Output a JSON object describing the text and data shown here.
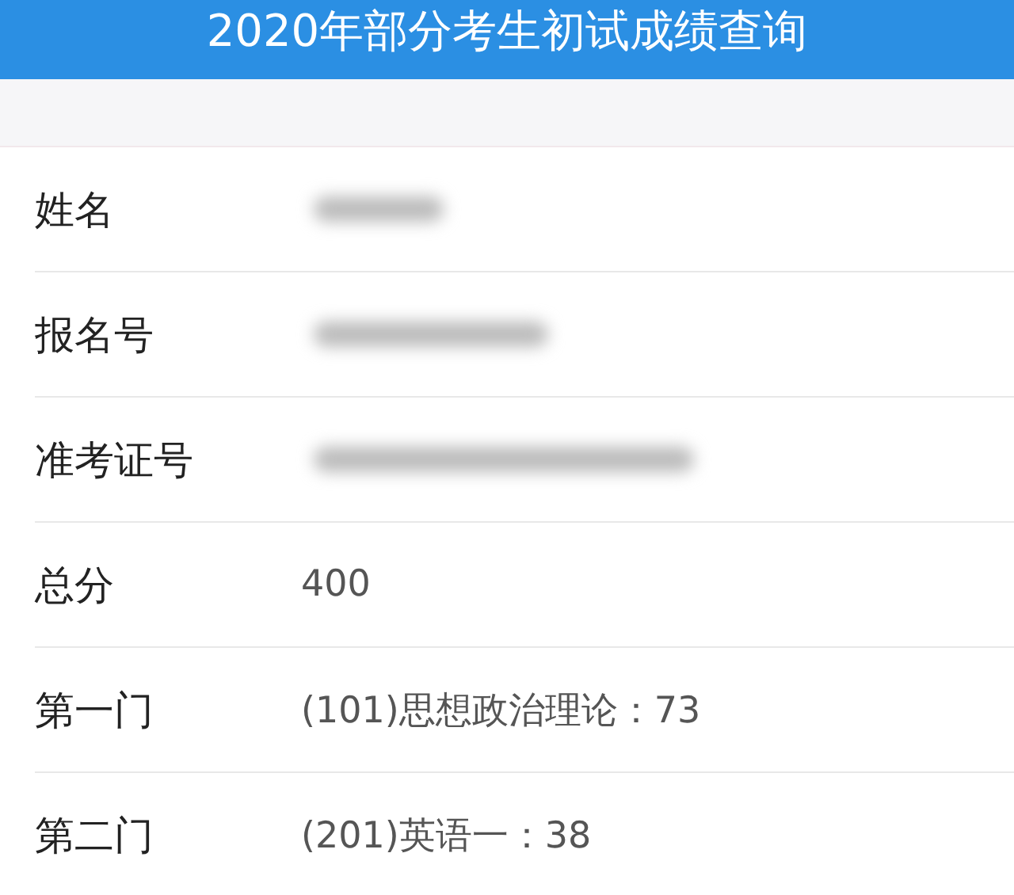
{
  "header": {
    "title": "2020年部分考生初试成绩查询"
  },
  "rows": [
    {
      "label": "姓名",
      "kind": "blurred"
    },
    {
      "label": "报名号",
      "kind": "blurred"
    },
    {
      "label": "准考证号",
      "kind": "blurred"
    },
    {
      "label": "总分",
      "kind": "text",
      "value": "400"
    },
    {
      "label": "第一门",
      "kind": "text",
      "value": "(101)思想政治理论：73"
    },
    {
      "label": "第二门",
      "kind": "text",
      "value": "(201)英语一：38"
    }
  ]
}
